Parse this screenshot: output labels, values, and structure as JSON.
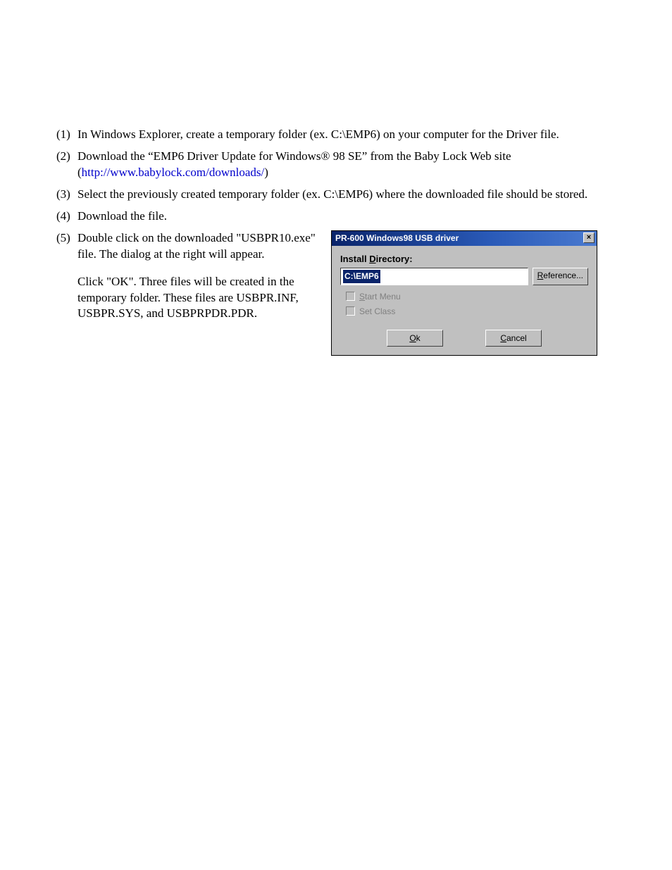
{
  "steps": {
    "s1": {
      "num": "(1)",
      "text": "In Windows Explorer, create a temporary folder (ex. C:\\EMP6) on your computer for the Driver file."
    },
    "s2": {
      "num": "(2)",
      "pre": "Download the “EMP6 Driver Update for Windows® 98 SE” from the Baby Lock Web site (",
      "link": "http://www.babylock.com/downloads/",
      "post": ")"
    },
    "s3": {
      "num": "(3)",
      "text": "Select the previously created temporary folder (ex. C:\\EMP6) where the downloaded file should be stored."
    },
    "s4": {
      "num": "(4)",
      "text": "Download the file."
    },
    "s5": {
      "num": "(5)",
      "p1": "Double click on the downloaded \"USBPR10.exe\" file. The dialog at the right will appear.",
      "p2": "Click \"OK\".  Three files will be created in the temporary folder. These files are USBPR.INF, USBPR.SYS, and USBPRPDR.PDR."
    }
  },
  "dialog": {
    "title": "PR-600 Windows98 USB driver",
    "close": "×",
    "label_pre": "Install ",
    "label_u": "D",
    "label_post": "irectory:",
    "dir_value": "C:\\EMP6",
    "reference_u": "R",
    "reference_rest": "eference...",
    "start_u": "S",
    "start_rest": "tart Menu",
    "setclass": "Set Class",
    "ok_u": "O",
    "ok_rest": "k",
    "cancel_u": "C",
    "cancel_rest": "ancel"
  }
}
